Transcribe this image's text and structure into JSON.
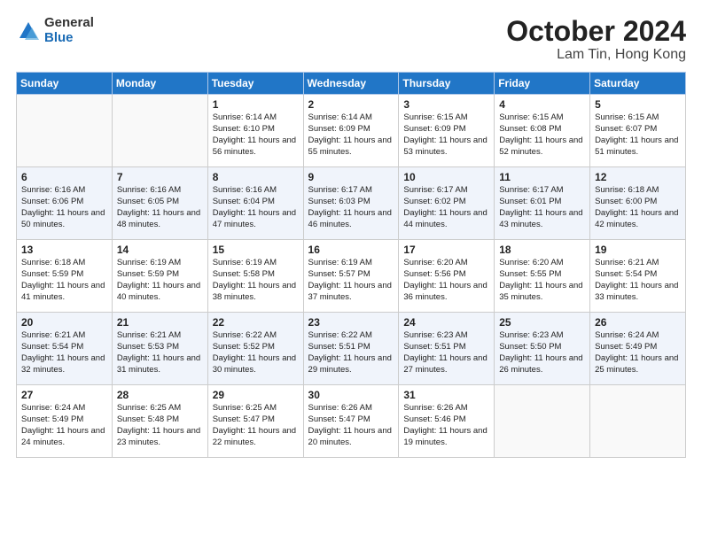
{
  "logo": {
    "general": "General",
    "blue": "Blue"
  },
  "title": "October 2024",
  "location": "Lam Tin, Hong Kong",
  "days_header": [
    "Sunday",
    "Monday",
    "Tuesday",
    "Wednesday",
    "Thursday",
    "Friday",
    "Saturday"
  ],
  "weeks": [
    [
      {
        "day": "",
        "detail": ""
      },
      {
        "day": "",
        "detail": ""
      },
      {
        "day": "1",
        "detail": "Sunrise: 6:14 AM\nSunset: 6:10 PM\nDaylight: 11 hours and 56 minutes."
      },
      {
        "day": "2",
        "detail": "Sunrise: 6:14 AM\nSunset: 6:09 PM\nDaylight: 11 hours and 55 minutes."
      },
      {
        "day": "3",
        "detail": "Sunrise: 6:15 AM\nSunset: 6:09 PM\nDaylight: 11 hours and 53 minutes."
      },
      {
        "day": "4",
        "detail": "Sunrise: 6:15 AM\nSunset: 6:08 PM\nDaylight: 11 hours and 52 minutes."
      },
      {
        "day": "5",
        "detail": "Sunrise: 6:15 AM\nSunset: 6:07 PM\nDaylight: 11 hours and 51 minutes."
      }
    ],
    [
      {
        "day": "6",
        "detail": "Sunrise: 6:16 AM\nSunset: 6:06 PM\nDaylight: 11 hours and 50 minutes."
      },
      {
        "day": "7",
        "detail": "Sunrise: 6:16 AM\nSunset: 6:05 PM\nDaylight: 11 hours and 48 minutes."
      },
      {
        "day": "8",
        "detail": "Sunrise: 6:16 AM\nSunset: 6:04 PM\nDaylight: 11 hours and 47 minutes."
      },
      {
        "day": "9",
        "detail": "Sunrise: 6:17 AM\nSunset: 6:03 PM\nDaylight: 11 hours and 46 minutes."
      },
      {
        "day": "10",
        "detail": "Sunrise: 6:17 AM\nSunset: 6:02 PM\nDaylight: 11 hours and 44 minutes."
      },
      {
        "day": "11",
        "detail": "Sunrise: 6:17 AM\nSunset: 6:01 PM\nDaylight: 11 hours and 43 minutes."
      },
      {
        "day": "12",
        "detail": "Sunrise: 6:18 AM\nSunset: 6:00 PM\nDaylight: 11 hours and 42 minutes."
      }
    ],
    [
      {
        "day": "13",
        "detail": "Sunrise: 6:18 AM\nSunset: 5:59 PM\nDaylight: 11 hours and 41 minutes."
      },
      {
        "day": "14",
        "detail": "Sunrise: 6:19 AM\nSunset: 5:59 PM\nDaylight: 11 hours and 40 minutes."
      },
      {
        "day": "15",
        "detail": "Sunrise: 6:19 AM\nSunset: 5:58 PM\nDaylight: 11 hours and 38 minutes."
      },
      {
        "day": "16",
        "detail": "Sunrise: 6:19 AM\nSunset: 5:57 PM\nDaylight: 11 hours and 37 minutes."
      },
      {
        "day": "17",
        "detail": "Sunrise: 6:20 AM\nSunset: 5:56 PM\nDaylight: 11 hours and 36 minutes."
      },
      {
        "day": "18",
        "detail": "Sunrise: 6:20 AM\nSunset: 5:55 PM\nDaylight: 11 hours and 35 minutes."
      },
      {
        "day": "19",
        "detail": "Sunrise: 6:21 AM\nSunset: 5:54 PM\nDaylight: 11 hours and 33 minutes."
      }
    ],
    [
      {
        "day": "20",
        "detail": "Sunrise: 6:21 AM\nSunset: 5:54 PM\nDaylight: 11 hours and 32 minutes."
      },
      {
        "day": "21",
        "detail": "Sunrise: 6:21 AM\nSunset: 5:53 PM\nDaylight: 11 hours and 31 minutes."
      },
      {
        "day": "22",
        "detail": "Sunrise: 6:22 AM\nSunset: 5:52 PM\nDaylight: 11 hours and 30 minutes."
      },
      {
        "day": "23",
        "detail": "Sunrise: 6:22 AM\nSunset: 5:51 PM\nDaylight: 11 hours and 29 minutes."
      },
      {
        "day": "24",
        "detail": "Sunrise: 6:23 AM\nSunset: 5:51 PM\nDaylight: 11 hours and 27 minutes."
      },
      {
        "day": "25",
        "detail": "Sunrise: 6:23 AM\nSunset: 5:50 PM\nDaylight: 11 hours and 26 minutes."
      },
      {
        "day": "26",
        "detail": "Sunrise: 6:24 AM\nSunset: 5:49 PM\nDaylight: 11 hours and 25 minutes."
      }
    ],
    [
      {
        "day": "27",
        "detail": "Sunrise: 6:24 AM\nSunset: 5:49 PM\nDaylight: 11 hours and 24 minutes."
      },
      {
        "day": "28",
        "detail": "Sunrise: 6:25 AM\nSunset: 5:48 PM\nDaylight: 11 hours and 23 minutes."
      },
      {
        "day": "29",
        "detail": "Sunrise: 6:25 AM\nSunset: 5:47 PM\nDaylight: 11 hours and 22 minutes."
      },
      {
        "day": "30",
        "detail": "Sunrise: 6:26 AM\nSunset: 5:47 PM\nDaylight: 11 hours and 20 minutes."
      },
      {
        "day": "31",
        "detail": "Sunrise: 6:26 AM\nSunset: 5:46 PM\nDaylight: 11 hours and 19 minutes."
      },
      {
        "day": "",
        "detail": ""
      },
      {
        "day": "",
        "detail": ""
      }
    ]
  ]
}
